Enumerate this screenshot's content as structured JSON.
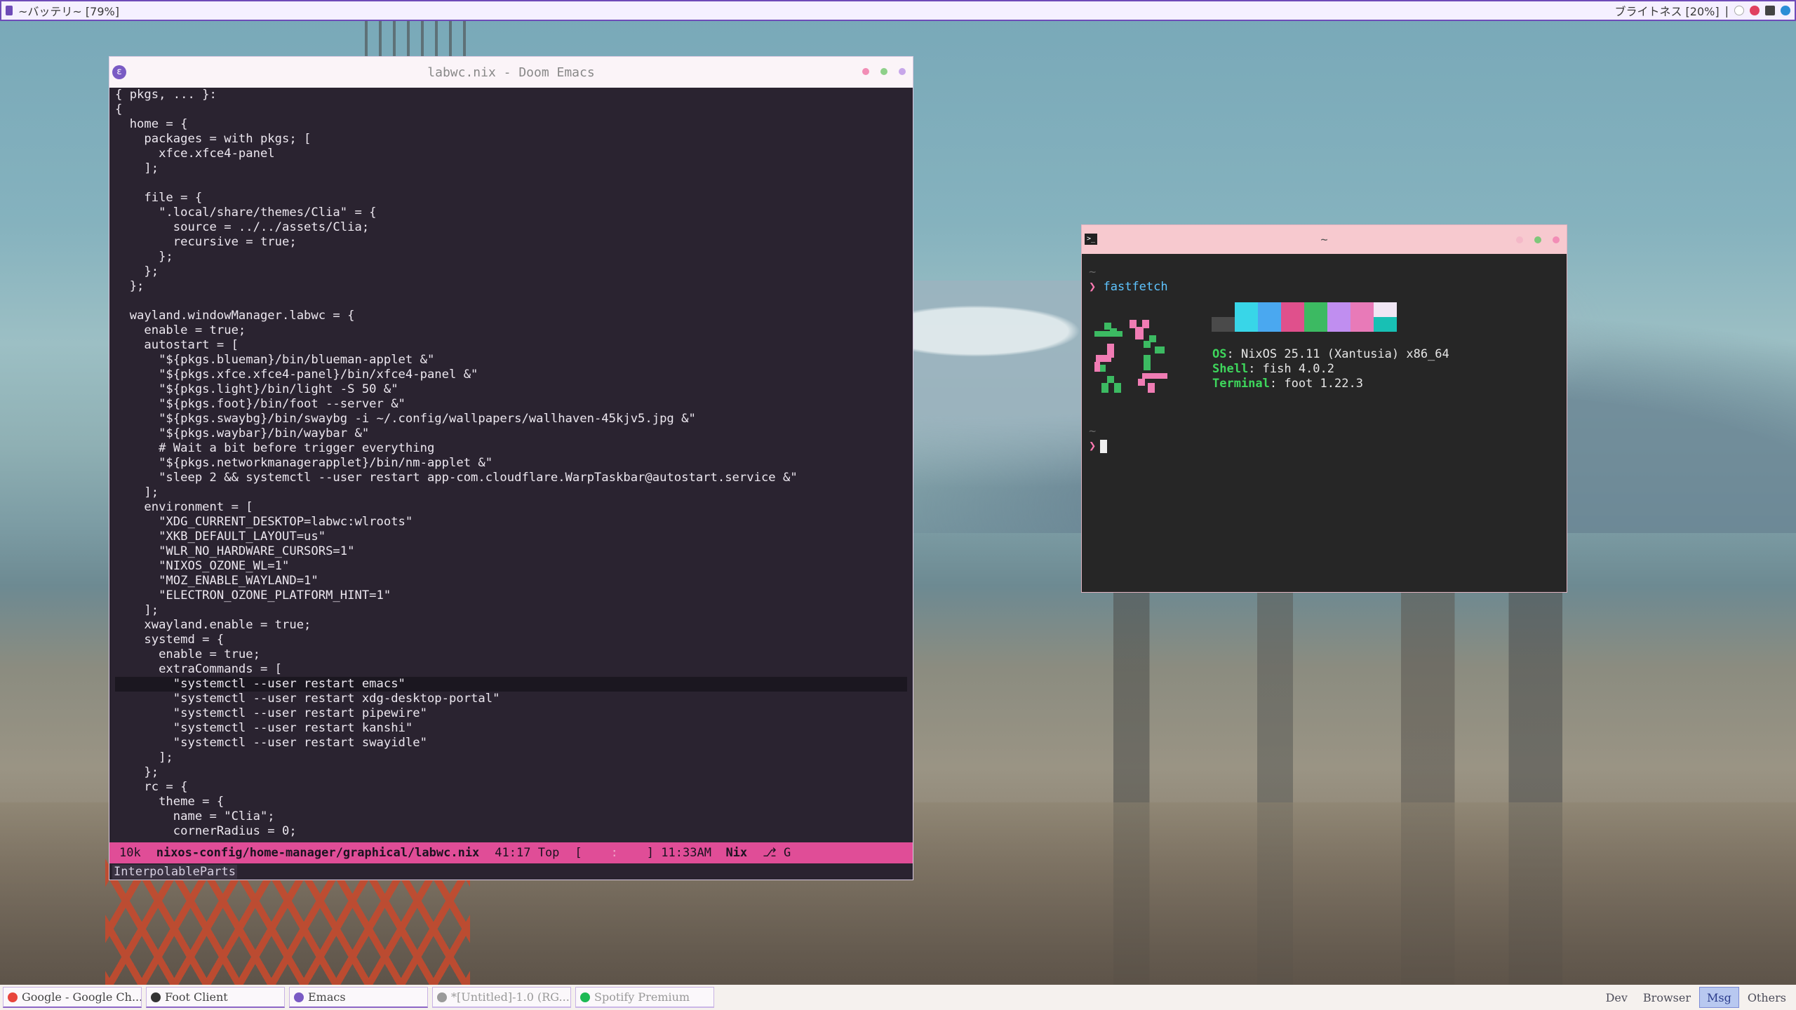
{
  "topbar": {
    "battery_label": "~バッテリ~ [79%]",
    "brightness_label": "ブライトネス [20%]",
    "separator": "|"
  },
  "emacs": {
    "title": "labwc.nix - Doom Emacs",
    "lines": [
      "{ pkgs, ... }:",
      "{",
      "  home = {",
      "    packages = with pkgs; [",
      "      xfce.xfce4-panel",
      "    ];",
      "",
      "    file = {",
      "      \".local/share/themes/Clia\" = {",
      "        source = ../../assets/Clia;",
      "        recursive = true;",
      "      };",
      "    };",
      "  };",
      "",
      "  wayland.windowManager.labwc = {",
      "    enable = true;",
      "    autostart = [",
      "      \"${pkgs.blueman}/bin/blueman-applet &\"",
      "      \"${pkgs.xfce.xfce4-panel}/bin/xfce4-panel &\"",
      "      \"${pkgs.light}/bin/light -S 50 &\"",
      "      \"${pkgs.foot}/bin/foot --server &\"",
      "      \"${pkgs.swaybg}/bin/swaybg -i ~/.config/wallpapers/wallhaven-45kjv5.jpg &\"",
      "      \"${pkgs.waybar}/bin/waybar &\"",
      "      # Wait a bit before trigger everything",
      "      \"${pkgs.networkmanagerapplet}/bin/nm-applet &\"",
      "      \"sleep 2 && systemctl --user restart app-com.cloudflare.WarpTaskbar@autostart.service &\"",
      "    ];",
      "    environment = [",
      "      \"XDG_CURRENT_DESKTOP=labwc:wlroots\"",
      "      \"XKB_DEFAULT_LAYOUT=us\"",
      "      \"WLR_NO_HARDWARE_CURSORS=1\"",
      "      \"NIXOS_OZONE_WL=1\"",
      "      \"MOZ_ENABLE_WAYLAND=1\"",
      "      \"ELECTRON_OZONE_PLATFORM_HINT=1\"",
      "    ];",
      "    xwayland.enable = true;",
      "    systemd = {",
      "      enable = true;",
      "      extraCommands = [",
      "        \"systemctl --user restart emacs\"",
      "        \"systemctl --user restart xdg-desktop-portal\"",
      "        \"systemctl --user restart pipewire\"",
      "        \"systemctl --user restart kanshi\"",
      "        \"systemctl --user restart swayidle\"",
      "      ];",
      "    };",
      "    rc = {",
      "      theme = {",
      "        name = \"Clia\";",
      "        cornerRadius = 0;"
    ],
    "highlighted_line": 40,
    "modeline": {
      "size": "10k",
      "path": "nixos-config/home-manager/graphical/labwc.nix",
      "position": "41:17 Top",
      "bracket_open": "[",
      "dim_text": "    :    ",
      "bracket_close": "]",
      "time": "11:33AM",
      "major_mode": "Nix",
      "vcs": "G"
    },
    "minibuffer": "InterpolableParts"
  },
  "foot": {
    "title": "~",
    "line1": "~",
    "prompt_symbol": "❯",
    "command": "fastfetch",
    "sysinfo": [
      {
        "key": "OS",
        "value": ": NixOS 25.11 (Xantusia) x86_64"
      },
      {
        "key": "Shell",
        "value": ": fish 4.0.2"
      },
      {
        "key": "Terminal",
        "value": ": foot 1.22.3"
      }
    ],
    "line_after": "~",
    "palette": [
      "#4a4a4a",
      "#38d6e8",
      "#4aa8f0",
      "#e0508c",
      "#3cba62",
      "#c08ef0",
      "#e87ab8",
      "#f0e6f4|#18c0b4"
    ]
  },
  "taskbar": {
    "tasks": [
      {
        "label": "Google - Google Ch...",
        "color": "#e8453c",
        "dim": false
      },
      {
        "label": "Foot Client",
        "color": "#333333",
        "dim": false
      },
      {
        "label": "Emacs",
        "color": "#7a5bc4",
        "dim": false
      },
      {
        "label": "*[Untitled]-1.0 (RG...",
        "color": "#9a9a9a",
        "dim": true
      },
      {
        "label": "Spotify Premium",
        "color": "#1db954",
        "dim": true
      }
    ],
    "workspaces": [
      {
        "label": "Dev",
        "active": false
      },
      {
        "label": "Browser",
        "active": false
      },
      {
        "label": "Msg",
        "active": true
      },
      {
        "label": "Others",
        "active": false
      }
    ]
  }
}
